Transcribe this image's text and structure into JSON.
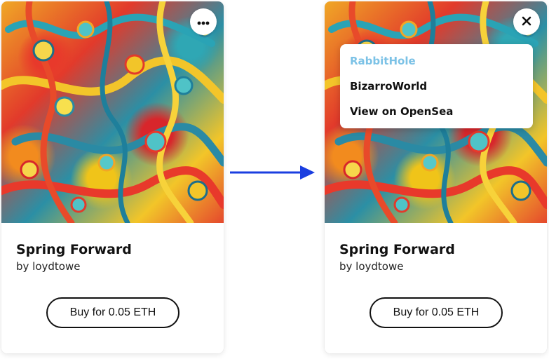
{
  "cards": [
    {
      "title": "Spring Forward",
      "byline": "by loydtowe",
      "buy_label": "Buy for 0.05 ETH",
      "corner_icon": "more-horizontal-icon"
    },
    {
      "title": "Spring Forward",
      "byline": "by loydtowe",
      "buy_label": "Buy for 0.05 ETH",
      "corner_icon": "close-icon",
      "menu": {
        "items": [
          {
            "label": "RabbitHole",
            "active": true
          },
          {
            "label": "BizarroWorld",
            "active": false
          },
          {
            "label": "View on OpenSea",
            "active": false
          }
        ]
      }
    }
  ],
  "transition_icon": "arrow-right-icon",
  "colors": {
    "arrow": "#1a3ee0",
    "menu_active": "#7cc2e6",
    "text": "#111111"
  }
}
